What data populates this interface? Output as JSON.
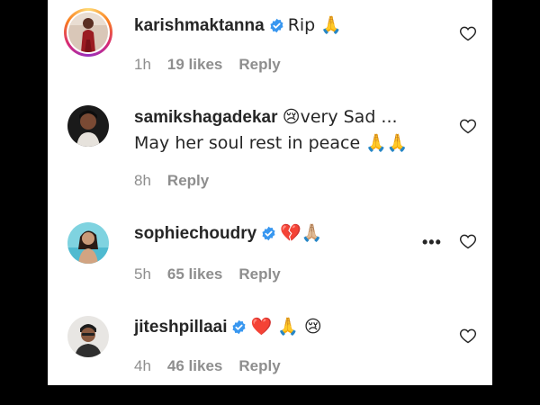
{
  "comments": [
    {
      "username": "karishmaktanna",
      "verified": true,
      "text": "Rip 🙏",
      "time": "1h",
      "likes": "19 likes",
      "reply": "Reply"
    },
    {
      "username": "samikshagadekar",
      "verified": false,
      "text": "😢very Sad ...",
      "text2": "May her soul rest in peace 🙏🙏",
      "time": "8h",
      "likes": "",
      "reply": "Reply"
    },
    {
      "username": "sophiechoudry",
      "verified": true,
      "text": "💔🙏🏼",
      "time": "5h",
      "likes": "65 likes",
      "reply": "Reply",
      "more": "•••"
    },
    {
      "username": "jiteshpillaai",
      "verified": true,
      "text": "❤️ 🙏 😢",
      "time": "4h",
      "likes": "46 likes",
      "reply": "Reply"
    }
  ],
  "icons": {
    "verified": "verified-badge-icon",
    "like": "heart-outline-icon",
    "more": "more-options-icon"
  },
  "colors": {
    "verified": "#3897f0",
    "meta": "#8e8e8e",
    "text": "#262626"
  }
}
